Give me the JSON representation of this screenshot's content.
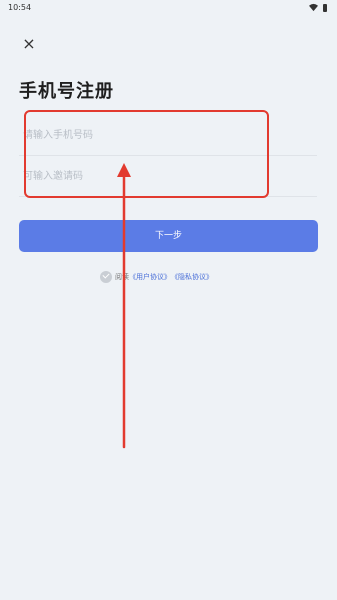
{
  "status_bar": {
    "time": "10:54",
    "icons": [
      "wifi-icon",
      "battery-icon"
    ]
  },
  "header": {
    "close_icon": "×",
    "title": "手机号注册"
  },
  "form": {
    "phone_placeholder": "请输入手机号码",
    "phone_value": "",
    "invite_placeholder": "可输入邀请码",
    "invite_value": "",
    "next_label": "下一步"
  },
  "agreement": {
    "prefix": "阅读",
    "user_agreement": "《用户协议》",
    "privacy_policy": "《隐私协议》"
  },
  "colors": {
    "background": "#eef2f6",
    "primary": "#5b7ce6",
    "annotation_red": "#e23a2f",
    "link": "#4a6fd8"
  }
}
